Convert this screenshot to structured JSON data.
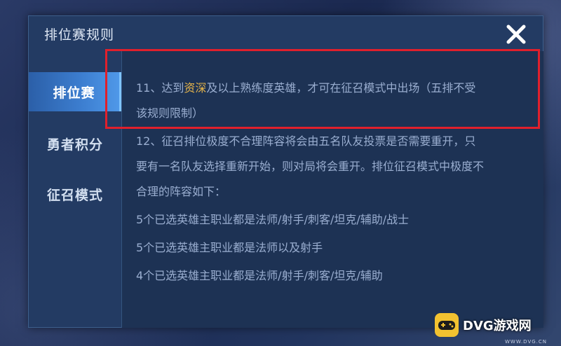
{
  "dialog": {
    "title": "排位赛规则"
  },
  "sidebar": {
    "tabs": [
      {
        "label": "排位赛",
        "active": true
      },
      {
        "label": "勇者积分",
        "active": false
      },
      {
        "label": "征召模式",
        "active": false
      }
    ]
  },
  "rules": {
    "r11_prefix": "11、达到",
    "r11_highlight": "资深",
    "r11_suffix": "及以上熟练度英雄，才可在征召模式中出场（五排不受",
    "r11_line2": "该规则限制）",
    "r12_line1": "12、征召排位极度不合理阵容将会由五名队友投票是否需要重开，只",
    "r12_line2": "要有一名队友选择重新开始，则对局将会重开。排位征召模式中极度不",
    "r12_line3": "合理的阵容如下：",
    "case1": "5个已选英雄主职业都是法师/射手/刺客/坦克/辅助/战士",
    "case2": "5个已选英雄主职业都是法师以及射手",
    "case3": "4个已选英雄主职业都是法师/射手/刺客/坦克/辅助"
  },
  "watermark": {
    "text": "DVG游戏网",
    "sub": "WWW.DVG.CN"
  },
  "colors": {
    "highlight": "#e7b54a",
    "annotation": "#e0202c",
    "active_tab": "#3d7fd1"
  }
}
